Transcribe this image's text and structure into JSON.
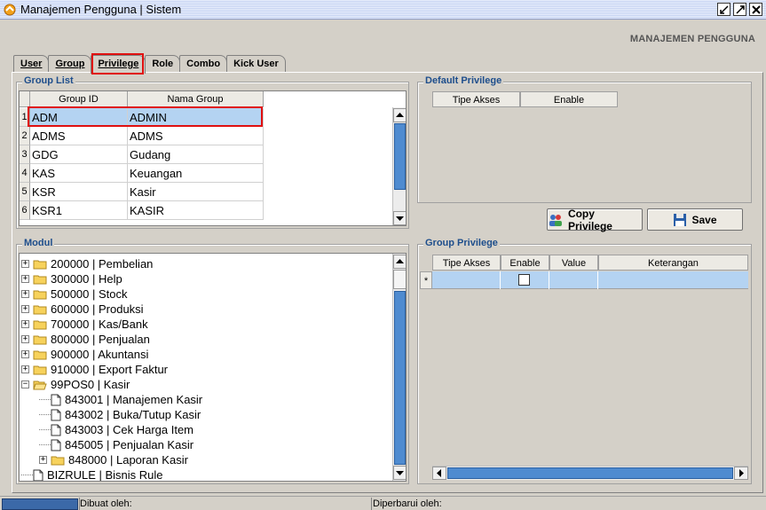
{
  "window": {
    "title": "Manajemen Pengguna | Sistem"
  },
  "header": {
    "title": "MANAJEMEN PENGGUNA"
  },
  "tabs": [
    {
      "label": "User",
      "active": false
    },
    {
      "label": "Group",
      "active": false
    },
    {
      "label": "Privilege",
      "active": true
    },
    {
      "label": "Role",
      "active": false
    },
    {
      "label": "Combo",
      "active": false
    },
    {
      "label": "Kick User",
      "active": false
    }
  ],
  "group_list": {
    "title": "Group List",
    "columns": [
      "Group ID",
      "Nama Group"
    ],
    "rows": [
      {
        "num": "1",
        "id": "ADM",
        "name": "ADMIN",
        "selected": true
      },
      {
        "num": "2",
        "id": "ADMS",
        "name": "ADMS"
      },
      {
        "num": "3",
        "id": "GDG",
        "name": "Gudang"
      },
      {
        "num": "4",
        "id": "KAS",
        "name": "Keuangan"
      },
      {
        "num": "5",
        "id": "KSR",
        "name": "Kasir"
      },
      {
        "num": "6",
        "id": "KSR1",
        "name": "KASIR"
      }
    ]
  },
  "default_privilege": {
    "title": "Default Privilege",
    "columns": [
      "Tipe Akses",
      "Enable"
    ]
  },
  "buttons": {
    "copy_privilege": "Copy Privilege",
    "save": "Save"
  },
  "modul": {
    "title": "Modul",
    "items": [
      {
        "label": "200000 | Pembelian",
        "type": "folder",
        "expander": "+"
      },
      {
        "label": "300000 | Help",
        "type": "folder",
        "expander": "+"
      },
      {
        "label": "500000 | Stock",
        "type": "folder",
        "expander": "+"
      },
      {
        "label": "600000 | Produksi",
        "type": "folder",
        "expander": "+"
      },
      {
        "label": "700000 | Kas/Bank",
        "type": "folder",
        "expander": "+"
      },
      {
        "label": "800000 | Penjualan",
        "type": "folder",
        "expander": "+"
      },
      {
        "label": "900000 | Akuntansi",
        "type": "folder",
        "expander": "+"
      },
      {
        "label": "910000 | Export Faktur",
        "type": "folder",
        "expander": "+"
      },
      {
        "label": "99POS0 | Kasir",
        "type": "folder-open",
        "expander": "-"
      },
      {
        "label": "843001 | Manajemen Kasir",
        "type": "file",
        "indent": 1
      },
      {
        "label": "843002 | Buka/Tutup Kasir",
        "type": "file",
        "indent": 1
      },
      {
        "label": "843003 | Cek Harga Item",
        "type": "file",
        "indent": 1
      },
      {
        "label": "845005 | Penjualan Kasir",
        "type": "file",
        "indent": 1
      },
      {
        "label": "848000 | Laporan Kasir",
        "type": "folder",
        "expander": "+",
        "indent": 1
      },
      {
        "label": "BIZRULE | Bisnis Rule",
        "type": "file"
      }
    ]
  },
  "group_privilege": {
    "title": "Group Privilege",
    "columns": [
      "Tipe Akses",
      "Enable",
      "Value",
      "Keterangan"
    ],
    "new_row_marker": "*"
  },
  "statusbar": {
    "created_label": "Dibuat oleh:",
    "updated_label": "Diperbarui oleh:"
  },
  "colors": {
    "accent": "#1e4e8c",
    "selection": "#b4d3f2",
    "highlight": "#e01010",
    "scroll_thumb": "#4f8bd0"
  }
}
